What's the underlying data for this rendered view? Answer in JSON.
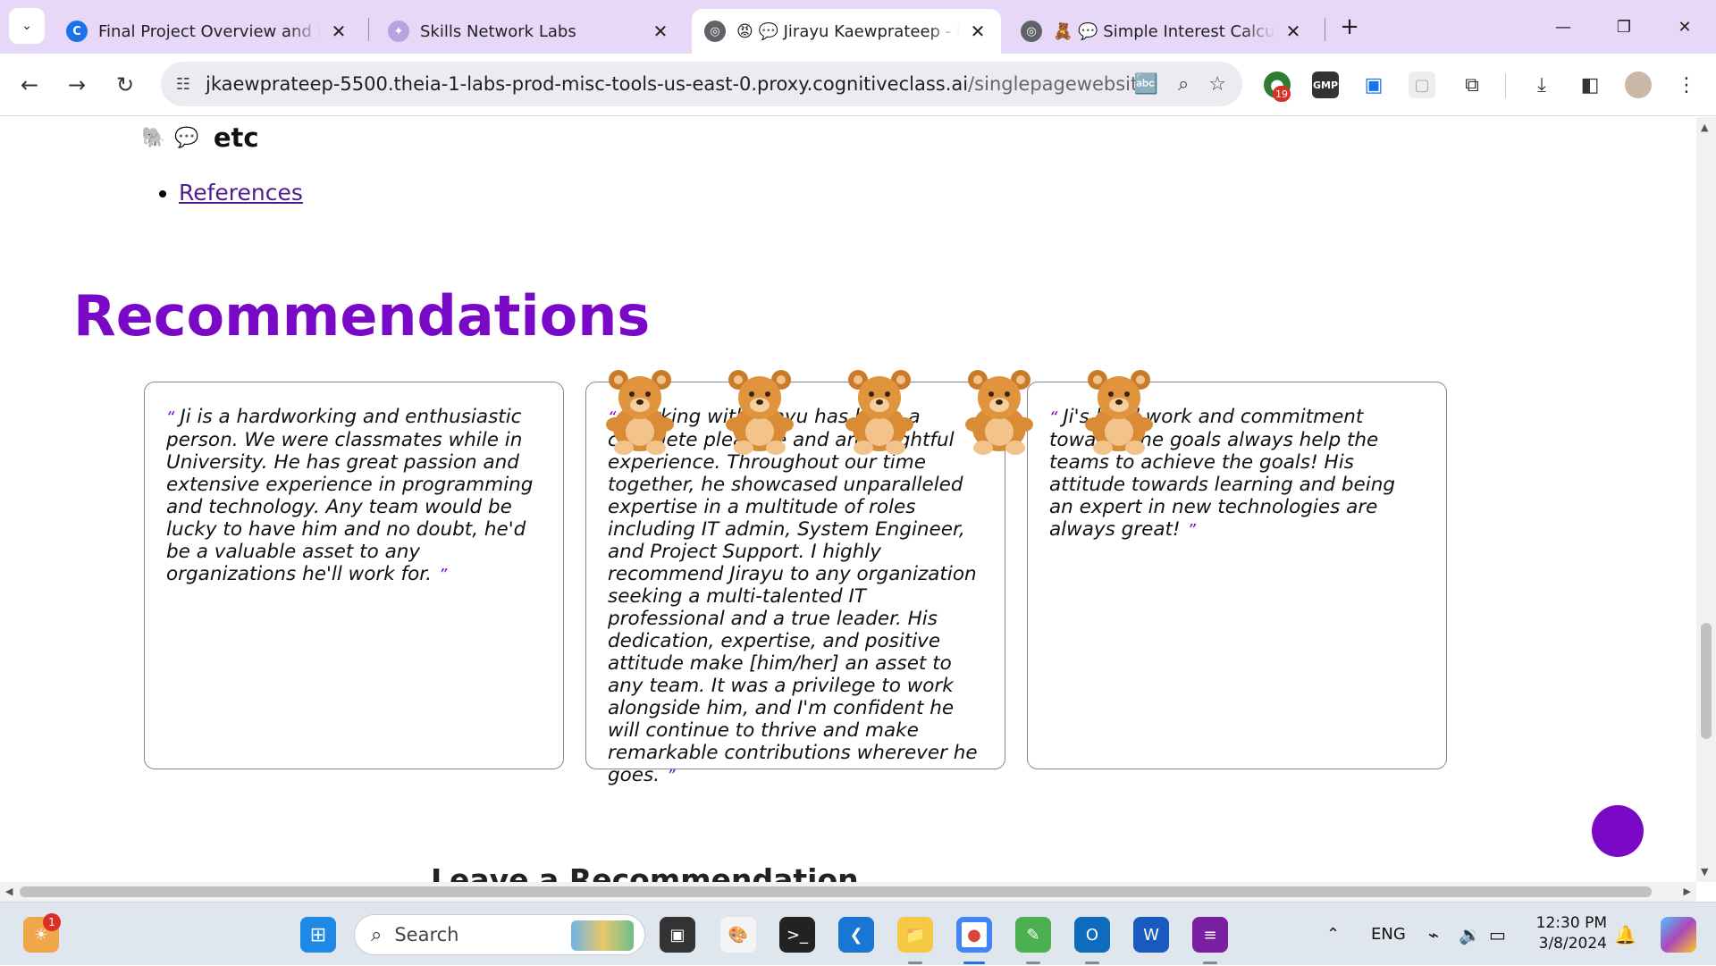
{
  "browser": {
    "tabs": [
      {
        "title": "Final Project Overview and Revi",
        "active": false
      },
      {
        "title": "Skills Network Labs",
        "active": false
      },
      {
        "title": "😡 💬 Jirayu Kaewprateep - Por",
        "active": true
      },
      {
        "title": "🧸 💬 Simple Interest Calculato",
        "active": false
      }
    ],
    "url_host": "jkaewprateep-5500.theia-1-labs-prod-misc-tools-us-east-0.proxy.cognitiveclass.ai",
    "url_path": "/singlepagewebsite/",
    "extension_badge": "19",
    "extension_gmp": "GMP"
  },
  "page": {
    "etc_label": "etc",
    "references_link": "References",
    "recommendations_heading": "Recommendations",
    "quote_open": "“",
    "quote_close": "”",
    "recommendations": [
      {
        "text": "Ji is a hardworking and enthusiastic person. We were classmates while in University. He has great passion and extensive experience in programming and technology. Any team would be lucky to have him and no doubt, he'd be a valuable asset to any organizations he'll work for."
      },
      {
        "text": "Working with Jirayu has been a complete pleasure and an insightful experience. Throughout our time together, he showcased unparalleled expertise in a multitude of roles including IT admin, System Engineer, and Project Support. I highly recommend Jirayu to any organization seeking a multi-talented IT professional and a true leader. His dedication, expertise, and positive attitude make [him/her] an asset to any team. It was a privilege to work alongside him, and I'm confident he will continue to thrive and make remarkable contributions wherever he goes."
      },
      {
        "text": "Ji's hard work and commitment towards the goals always help the teams to achieve the goals! His attitude towards learning and being an expert in new technologies are always great!"
      }
    ],
    "leave_heading": "Leave a Recommendation"
  },
  "taskbar": {
    "search_label": "Search",
    "notification_count": "1",
    "language": "ENG",
    "time": "12:30 PM",
    "date": "3/8/2024"
  },
  "colors": {
    "accent": "#7a09c7",
    "tabstrip": "#e8d8f7",
    "link": "#551a8b"
  },
  "icons": [
    "chevron-down-icon",
    "back-icon",
    "forward-icon",
    "reload-icon",
    "site-info-icon",
    "translate-icon",
    "zoom-icon",
    "star-icon",
    "camera-icon",
    "puzzle-icon",
    "download-icon",
    "sidepanel-icon",
    "menu-icon",
    "teddy-bear-icon",
    "windows-start-icon",
    "search-icon",
    "wifi-icon",
    "volume-icon",
    "battery-icon"
  ]
}
